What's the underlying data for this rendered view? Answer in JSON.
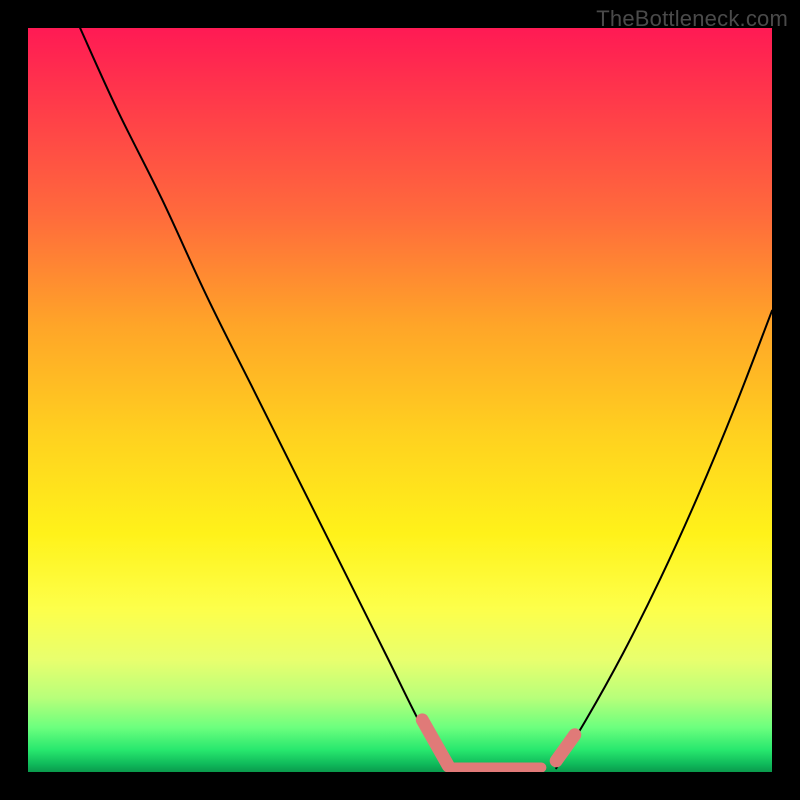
{
  "watermark": "TheBottleneck.com",
  "colors": {
    "curve": "#000000",
    "highlight": "#e07a78",
    "frame": "#000000"
  },
  "chart_data": {
    "type": "line",
    "title": "",
    "xlabel": "",
    "ylabel": "",
    "xlim": [
      0,
      100
    ],
    "ylim": [
      0,
      100
    ],
    "grid": false,
    "legend": false,
    "note": "Values are estimated from pixel positions; the image has no tick labels. y=100 is top of plot, y=0 is bottom. Two curve branches form a V with a flat bottom; a salmon highlight band marks the low region.",
    "series": [
      {
        "name": "left_branch",
        "x": [
          7,
          12,
          18,
          24,
          30,
          36,
          42,
          48,
          53,
          56.5
        ],
        "y": [
          100,
          89,
          77,
          64,
          52,
          40,
          28,
          16,
          6,
          0.5
        ]
      },
      {
        "name": "right_branch",
        "x": [
          71,
          75,
          80,
          85,
          90,
          95,
          100
        ],
        "y": [
          0.5,
          7,
          16,
          26,
          37,
          49,
          62
        ]
      },
      {
        "name": "highlight_left_segment",
        "x": [
          53,
          56.5
        ],
        "y": [
          7,
          0.8
        ]
      },
      {
        "name": "highlight_flat_segment",
        "x": [
          56.5,
          69
        ],
        "y": [
          0.6,
          0.6
        ]
      },
      {
        "name": "highlight_right_dot",
        "x": [
          71,
          73.5
        ],
        "y": [
          1.5,
          5
        ]
      }
    ]
  }
}
